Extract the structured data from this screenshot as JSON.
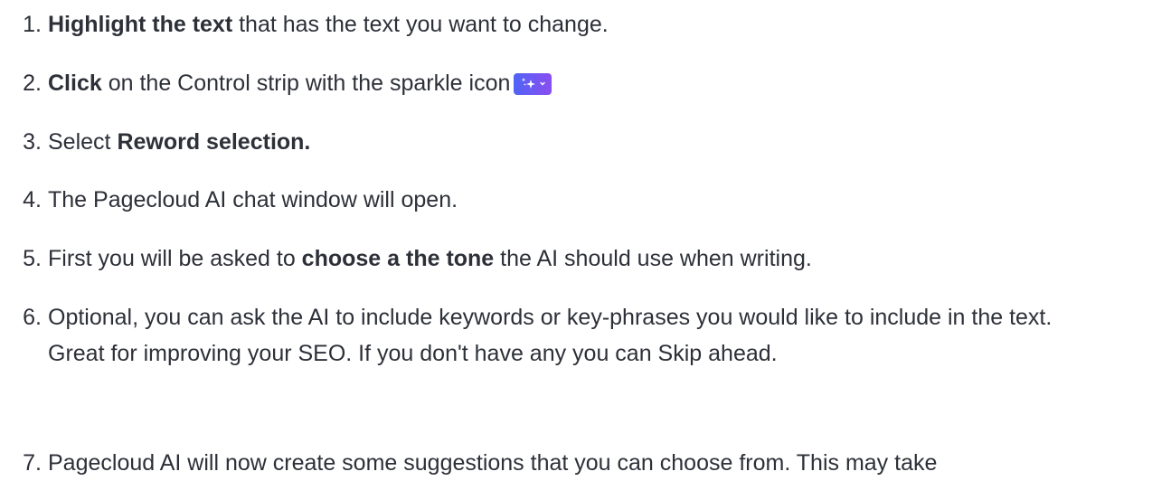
{
  "steps": [
    {
      "number": "1.",
      "bold_lead": "Highlight the text",
      "rest": " that has the text you want to change."
    },
    {
      "number": "2.",
      "bold_lead": "Click",
      "rest": " on the Control strip with the sparkle icon",
      "icon": "sparkle-icon",
      "icon_colors": [
        "#4f64f5",
        "#8b4df1"
      ]
    },
    {
      "number": "3.",
      "pre": "Select ",
      "bold_lead": "Reword selection."
    },
    {
      "number": "4.",
      "pre": "The Pagecloud AI chat window will open."
    },
    {
      "number": "5.",
      "pre": "First you will be asked to ",
      "bold_lead": "choose a the tone",
      "rest": " the AI should use when writing."
    },
    {
      "number": "6.",
      "pre": "Optional, you can ask the AI to include keywords or key-phrases you would like to include in the text.  Great for improving your SEO. If you don't have any you can Skip ahead."
    },
    {
      "number": "7.",
      "pre": "Pagecloud AI will now create some suggestions that you can choose from. This may take"
    }
  ]
}
